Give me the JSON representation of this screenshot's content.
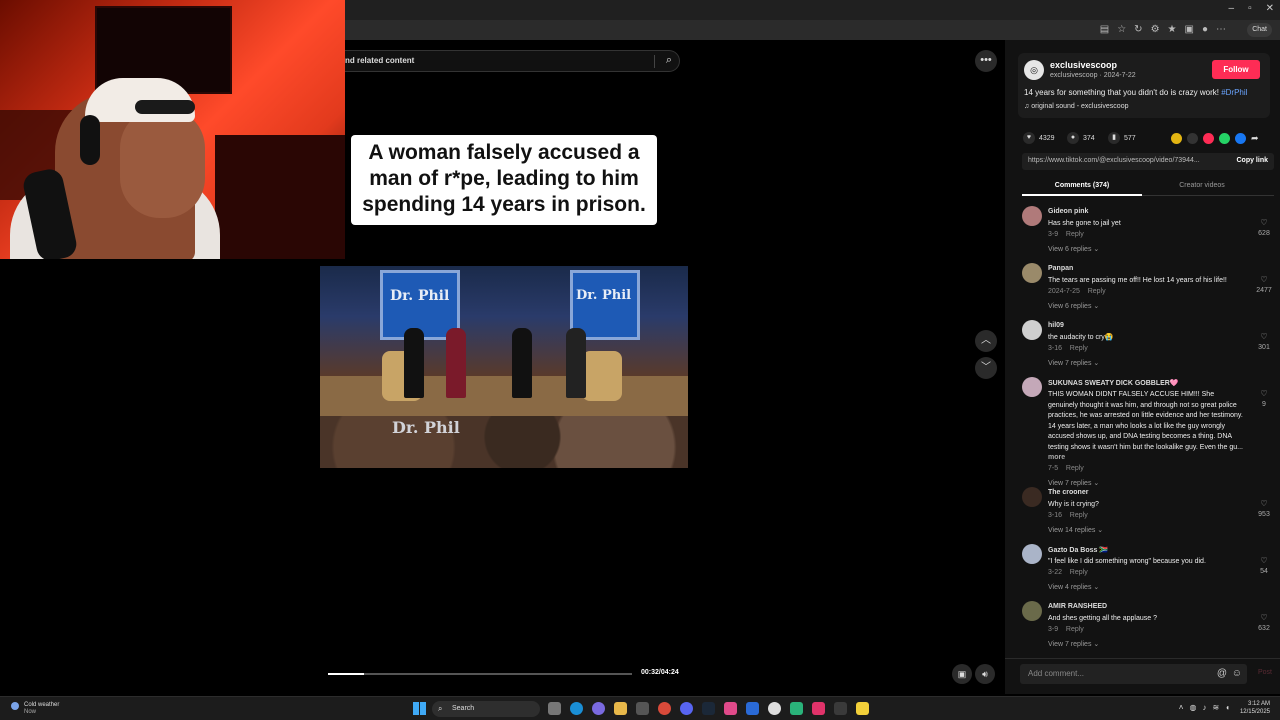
{
  "browser": {
    "chat_label": "Chat"
  },
  "search": {
    "placeholder": "nd related content"
  },
  "video": {
    "caption": "A woman falsely accused a man of r*pe, leading to him spending 14 years in prison.",
    "show_logo": "Dr. Phil",
    "time": "00:32/04:24",
    "progress": 0.12
  },
  "post": {
    "username": "exclusivescoop",
    "sub": "exclusivescoop · 2024-7-22",
    "follow_label": "Follow",
    "description": "14 years for something that you didn't do is crazy work!",
    "hashtag": "#DrPhil",
    "sound": "original sound - exclusivescoop",
    "likes": "4329",
    "comments_count": "374",
    "saves": "577",
    "link": "https://www.tiktok.com/@exclusivescoop/video/73944...",
    "copy_link_label": "Copy link"
  },
  "tabs": {
    "comments": "Comments (374)",
    "creator_videos": "Creator videos"
  },
  "comments": [
    {
      "name": "Gideon pink",
      "text": "Has she gone to jail yet",
      "date": "3-9",
      "reply": "Reply",
      "replies": "View 6 replies",
      "likes": "628",
      "avatar_color": "#b07a7a"
    },
    {
      "name": "Panpan",
      "text": "The tears are passing me off!! He lost 14 years of his life!!",
      "date": "2024-7-25",
      "reply": "Reply",
      "replies": "View 6 replies",
      "likes": "2477",
      "avatar_color": "#9a8a6a"
    },
    {
      "name": "hil09",
      "text": "the audacity to cry😭",
      "date": "3-16",
      "reply": "Reply",
      "replies": "View 7 replies",
      "likes": "301",
      "avatar_color": "#cfcfcf"
    },
    {
      "name": "SUKUNAS SWEATY DICK GOBBLER🩷",
      "text": "THIS WOMAN DIDNT FALSELY ACCUSE HIM!!! She genuinely thought it was him, and through not so great police practices, he was arrested on little evidence and her testimony. 14 years later, a man who looks a lot like the guy wrongly accused shows up, and DNA testing becomes a thing. DNA testing shows it wasn't him but the lookalike guy. Even the gu...",
      "more": "more",
      "date": "7-5",
      "reply": "Reply",
      "replies": "View 7 replies",
      "likes": "9",
      "avatar_color": "#c4a8b8"
    },
    {
      "name": "The crooner",
      "text": "Why is it crying?",
      "date": "3-16",
      "reply": "Reply",
      "replies": "View 14 replies",
      "likes": "953",
      "avatar_color": "#3a2a22"
    },
    {
      "name": "Gazto Da Boss 🇿🇦",
      "text": "\"I feel like I did something wrong\" because you did.",
      "date": "3-22",
      "reply": "Reply",
      "replies": "View 4 replies",
      "likes": "54",
      "avatar_color": "#aab4c8"
    },
    {
      "name": "AMIR RANSHEED",
      "text": "And shes getting all the applause ?",
      "date": "3-9",
      "reply": "Reply",
      "replies": "View 7 replies",
      "likes": "632",
      "avatar_color": "#6a6a4a"
    }
  ],
  "add_comment": {
    "placeholder": "Add comment...",
    "post_label": "Post"
  },
  "taskbar": {
    "weather": "Cold weather",
    "weather_sub": "Now",
    "search_label": "Search",
    "time": "3:12 AM",
    "date": "12/15/2025"
  },
  "colors": {
    "follow": "#fe2c55",
    "hashtag": "#6aa4ff",
    "accent_blue": "#3fa9f5"
  }
}
